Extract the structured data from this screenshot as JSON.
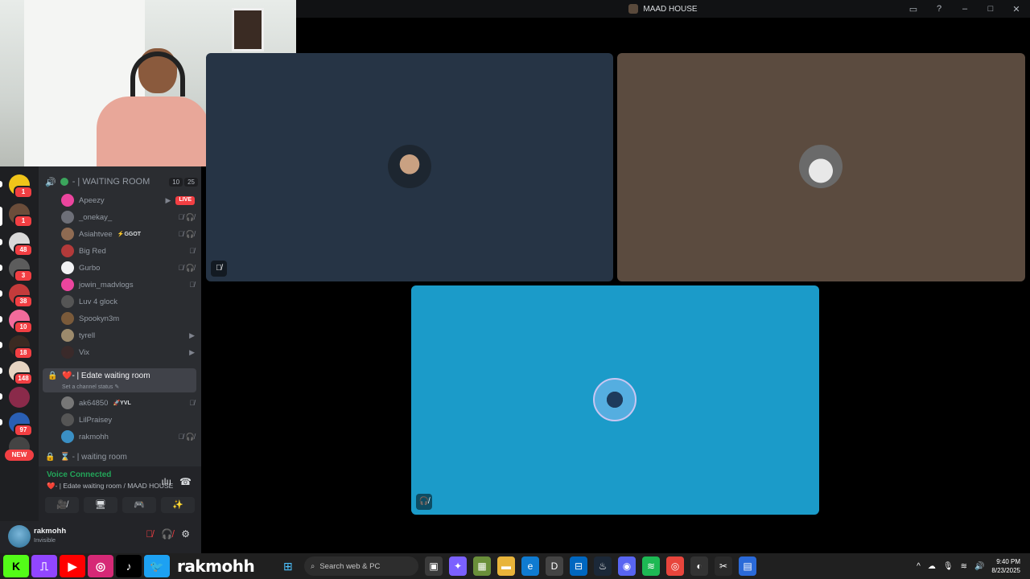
{
  "window": {
    "title": "MAAD HOUSE"
  },
  "titlebar_icons": {
    "inbox": "▭",
    "help": "?",
    "minimize": "–",
    "maximize": "□",
    "close": "✕"
  },
  "voice_channel": {
    "name": "WAITING ROOM",
    "prefix": "🔊",
    "video_count": "10",
    "user_count": "25",
    "users": [
      {
        "name": "Apeezy",
        "badge": "LIVE",
        "icons": "▶"
      },
      {
        "name": "_onekay_",
        "icons": "🎙̸ 🎧̸"
      },
      {
        "name": "Asiahtvee",
        "tag": "⚡GGOT",
        "icons": "🎙̸ 🎧̸"
      },
      {
        "name": "Big Red",
        "icons": "🎙̸"
      },
      {
        "name": "Gurbo",
        "icons": "🎙̸ 🎧̸"
      },
      {
        "name": "jowin_madvlogs",
        "icons": "🎙̸"
      },
      {
        "name": "Luv 4 glock",
        "icons": ""
      },
      {
        "name": "Spookyn3m",
        "icons": ""
      },
      {
        "name": "tyrell",
        "icons": "▶"
      },
      {
        "name": "Vix",
        "icons": "▶"
      }
    ]
  },
  "active_channel": {
    "name": "❤️- | Edate waiting room",
    "status_placeholder": "Set a channel status ✎",
    "users": [
      {
        "name": "ak64850",
        "tag": "🚀YVL",
        "icons": "🎙̸"
      },
      {
        "name": "LilPraisey",
        "icons": ""
      },
      {
        "name": "rakmohh",
        "icons": "🎙̸ 🎧̸"
      }
    ]
  },
  "next_channel": {
    "name": "⌛ - | waiting room"
  },
  "server_rail": {
    "badges": [
      "1",
      "1",
      "48",
      "3",
      "38",
      "10",
      "18",
      "148",
      "",
      "97"
    ],
    "new_label": "NEW"
  },
  "voice_status": {
    "connected_label": "Voice Connected",
    "location": "❤️- | Edate waiting room / MAAD HOUSE",
    "buttons": [
      "🎥̸",
      "🖥",
      "🎮",
      "✨"
    ]
  },
  "user_panel": {
    "name": "rakmohh",
    "status": "Invisible"
  },
  "stage": {
    "tiles": [
      {
        "bg": "#263445"
      },
      {
        "bg": "#5b4b3f"
      },
      {
        "bg": "#1b9bc9"
      }
    ]
  },
  "taskbar": {
    "socials": [
      "K",
      "⎍",
      "▶",
      "◎",
      "♪",
      "🐦"
    ],
    "handle": "rakmohh",
    "search_placeholder": "Search web & PC",
    "time": "9:40 PM",
    "date": "8/23/2025"
  }
}
